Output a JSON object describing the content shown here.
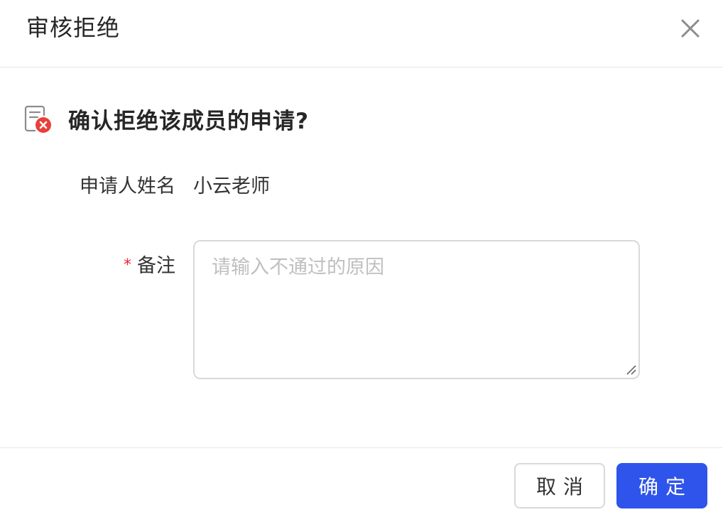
{
  "dialog": {
    "title": "审核拒绝",
    "question": "确认拒绝该成员的申请?"
  },
  "form": {
    "applicant_label": "申请人姓名",
    "applicant_value": "小云老师",
    "required_mark": "*",
    "remark_label": "备注",
    "remark_placeholder": "请输入不通过的原因",
    "remark_value": ""
  },
  "footer": {
    "cancel_label": "取消",
    "ok_label": "确定"
  },
  "colors": {
    "primary": "#2f54eb",
    "danger": "#e8403a",
    "required": "#f5222d"
  },
  "icons": {
    "close": "close-icon",
    "reject_document": "reject-document-icon"
  }
}
